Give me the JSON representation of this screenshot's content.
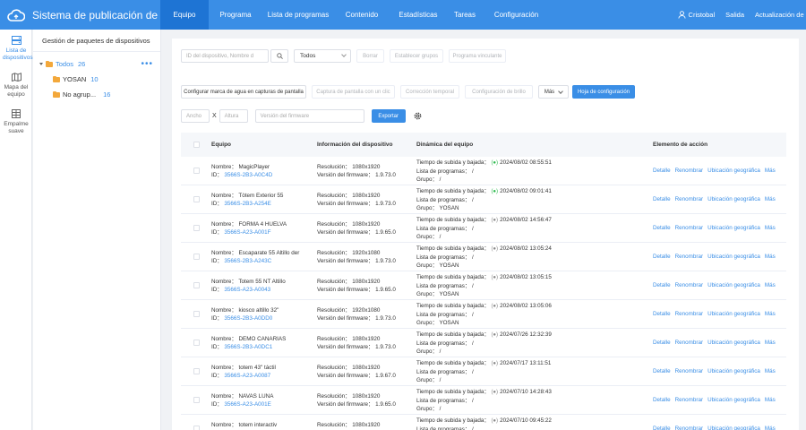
{
  "app": {
    "title": "Sistema de publicación de ..."
  },
  "nav": [
    {
      "label": "Equipo",
      "active": true
    },
    {
      "label": "Programa",
      "active": false
    },
    {
      "label": "Lista de programas",
      "active": false
    },
    {
      "label": "Contenido",
      "active": false
    },
    {
      "label": "Estadísticas",
      "active": false
    },
    {
      "label": "Tareas",
      "active": false
    },
    {
      "label": "Configuración",
      "active": false
    }
  ],
  "top_right": {
    "user": "Cristobal",
    "logout": "Salida",
    "update": "Actualización de las direc"
  },
  "sidebar": [
    {
      "label": "Lista de dispositivos",
      "icon": "server-icon",
      "active": true
    },
    {
      "label": "Mapa del equipo",
      "icon": "map-icon",
      "active": false
    },
    {
      "label": "Empalme suave",
      "icon": "grid-icon",
      "active": false
    }
  ],
  "tree": {
    "title": "Gestión de paquetes de dispositivos",
    "root": {
      "label": "Todos",
      "count": "26"
    },
    "children": [
      {
        "label": "YOSAN",
        "count": "10"
      },
      {
        "label": "No agrup...",
        "count": "16"
      }
    ]
  },
  "toolbar": {
    "search_placeholder": "ID del dispositivo,  Nombre d",
    "select_value": "Todos",
    "btn_borrar": "Borrar",
    "btn_grupos": "Establecer grupos",
    "btn_programa": "Programa vinculante",
    "btn_watermark": "Configurar marca de agua en capturas de pantalla",
    "btn_captura": "Captura de pantalla con un clic",
    "btn_correccion": "Corrección temporal",
    "btn_brillo": "Configuración de brillo",
    "btn_mas": "Más",
    "btn_hoja": "Hoja de configuración",
    "ancho_placeholder": "Ancho",
    "x_label": "X",
    "altura_placeholder": "Altura",
    "firmware_placeholder": "Versión del firmware",
    "btn_exportar": "Exportar"
  },
  "table": {
    "headers": [
      "Equipo",
      "Información del dispositivo",
      "Dinámica del equipo",
      "Elemento de acción"
    ],
    "labels": {
      "name": "Nombre：",
      "id": "ID：",
      "res": "Resolución：",
      "fw": "Versión del firmware：",
      "time": "Tiempo de subida y bajada：",
      "list": "Lista de programas：",
      "group": "Grupo："
    },
    "actions": [
      "Detalle",
      "Renombrar",
      "Ubicación geográfica",
      "Más"
    ],
    "rows": [
      {
        "name": "MagicPlayer",
        "id": "3566S-2B3-A0C4D",
        "res": "1080x1920",
        "fw": "1.9.73.0",
        "online": true,
        "time": "2024/08/02 08:55:51",
        "list": "/",
        "group": "/"
      },
      {
        "name": "Tòtem Exterior 55",
        "id": "3566S-2B3-A254E",
        "res": "1080x1920",
        "fw": "1.9.73.0",
        "online": true,
        "time": "2024/08/02 09:01:41",
        "list": "/",
        "group": "YOSAN"
      },
      {
        "name": "FORMA 4 HUELVA",
        "id": "3566S-A23-A001F",
        "res": "1080x1920",
        "fw": "1.9.65.0",
        "online": false,
        "time": "2024/08/02 14:56:47",
        "list": "/",
        "group": "/"
      },
      {
        "name": "Escaparate 55 Altillo der",
        "id": "3566S-2B3-A243C",
        "res": "1920x1080",
        "fw": "1.9.73.0",
        "online": false,
        "time": "2024/08/02 13:05:24",
        "list": "/",
        "group": "YOSAN"
      },
      {
        "name": "Totem 55 NT Altillo",
        "id": "3566S-A23-A0043",
        "res": "1080x1920",
        "fw": "1.9.65.0",
        "online": false,
        "time": "2024/08/02 13:05:15",
        "list": "/",
        "group": "YOSAN"
      },
      {
        "name": "kiosco altillo 32\"",
        "id": "3566S-2B3-A0DD0",
        "res": "1920x1080",
        "fw": "1.9.73.0",
        "online": false,
        "time": "2024/08/02 13:05:06",
        "list": "/",
        "group": "YOSAN"
      },
      {
        "name": "DEMO CANARIAS",
        "id": "3566S-2B3-A0DC1",
        "res": "1080x1920",
        "fw": "1.9.73.0",
        "online": false,
        "time": "2024/07/26 12:32:39",
        "list": "/",
        "group": "/"
      },
      {
        "name": "totem 43\" táctil",
        "id": "3566S-A23-A0087",
        "res": "1080x1920",
        "fw": "1.9.67.0",
        "online": false,
        "time": "2024/07/17 13:11:51",
        "list": "/",
        "group": "/"
      },
      {
        "name": "NAVAS LUNA",
        "id": "3566S-A23-A001E",
        "res": "1080x1920",
        "fw": "1.9.65.0",
        "online": false,
        "time": "2024/07/10 14:28:43",
        "list": "/",
        "group": "/"
      },
      {
        "name": "totem interactiv",
        "id": "",
        "res": "1080x1920",
        "fw": "",
        "online": false,
        "time": "2024/07/10 09:45:22",
        "list": "/",
        "group": ""
      }
    ]
  }
}
